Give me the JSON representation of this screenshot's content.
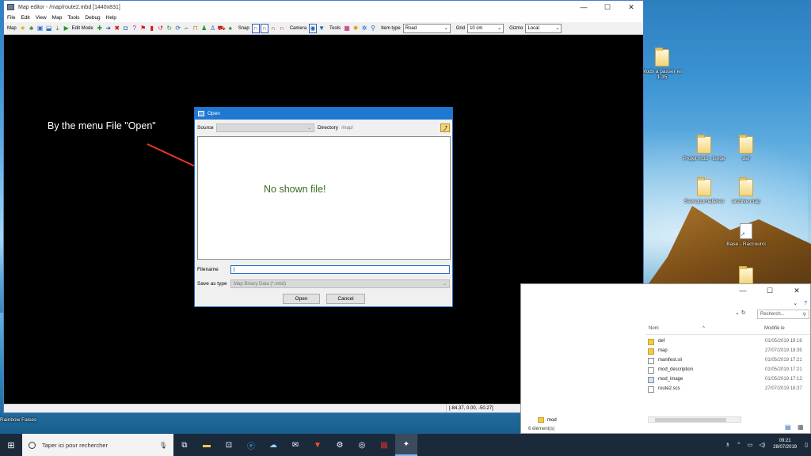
{
  "desktop": {
    "icons": [
      {
        "label": "Mods à passer en 1.35",
        "type": "folder"
      },
      {
        "label": "Projet mod - longe",
        "type": "folder"
      },
      {
        "label": "def",
        "type": "folder"
      },
      {
        "label": "Save journalières",
        "type": "folder"
      },
      {
        "label": "archive.map",
        "type": "folder"
      },
      {
        "label": "Base - Raccourci",
        "type": "shortcut"
      },
      {
        "label": "Rainbow Falses",
        "type": "label"
      }
    ]
  },
  "editor": {
    "title": "Map editor - /map/route2.mbd [1440x831]",
    "menu": [
      "File",
      "Edit",
      "View",
      "Map",
      "Tools",
      "Debug",
      "Help"
    ],
    "toolbar": {
      "map_label": "Map",
      "edit_mode_label": "Edit Mode",
      "snap_label": "Snap",
      "camera_label": "Camera",
      "tools_label": "Tools",
      "item_type_label": "Item type",
      "item_type_value": "Road",
      "grid_label": "Grid",
      "grid_value": "10 cm",
      "gizmo_label": "Gizmo",
      "gizmo_value": "Local"
    },
    "status_coords": "[-84.37, 0.00, -50.27]"
  },
  "annotations": {
    "menu_hint": "By the menu File \"Open\"",
    "no_file": "No shown file!",
    "arrow_color": "#e23a22"
  },
  "dialog": {
    "title": "Open",
    "source_label": "Source",
    "directory_label": "Directory",
    "directory_value": "/map/",
    "filename_label": "Filename",
    "save_as_type_label": "Save as type",
    "save_as_type_value": "Map Binary Data (*.mbd)",
    "open_button": "Open",
    "cancel_button": "Cancel"
  },
  "explorer": {
    "search_placeholder": "Recherch...",
    "col_name": "Nom",
    "col_modified": "Modifié le",
    "rows": [
      {
        "name": "def",
        "date": "01/05/2019 19:16",
        "kind": "folder"
      },
      {
        "name": "map",
        "date": "27/07/2019 18:35",
        "kind": "folder"
      },
      {
        "name": "manifest.sii",
        "date": "01/05/2019 17:21",
        "kind": "file"
      },
      {
        "name": "mod_description",
        "date": "01/05/2019 17:21",
        "kind": "file"
      },
      {
        "name": "mod_image",
        "date": "01/05/2019 17:13",
        "kind": "file"
      },
      {
        "name": "route2.scs",
        "date": "27/07/2019 18:37",
        "kind": "file"
      }
    ],
    "footer_folder": "mod",
    "footer_count": "6 élément(s)"
  },
  "taskbar": {
    "search_placeholder": "Taper ici pour rechercher",
    "time": "09:21",
    "date": "28/07/2019"
  }
}
